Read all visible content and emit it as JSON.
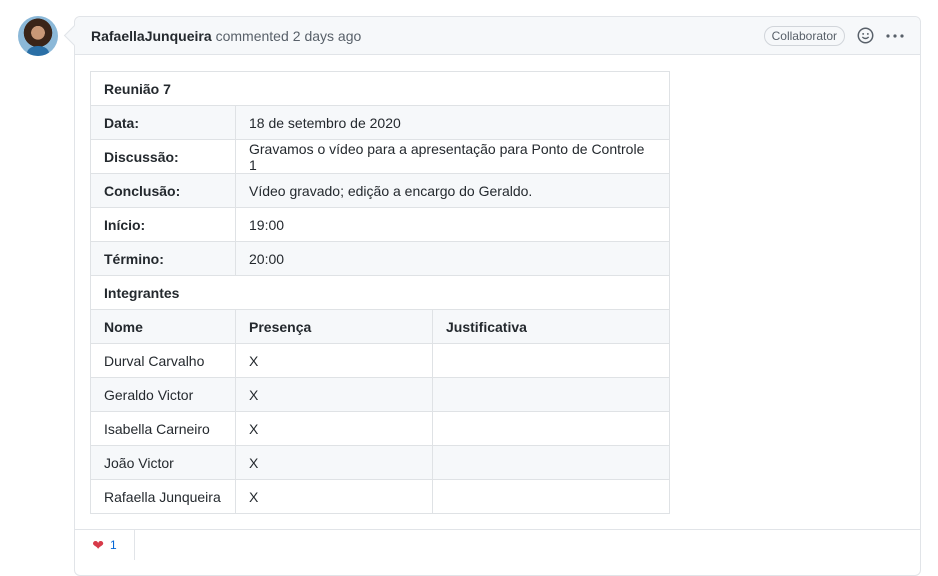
{
  "comment": {
    "author": "RafaellaJunqueira",
    "action": "commented",
    "time": "2 days ago",
    "badge": "Collaborator",
    "icons": {
      "reaction": "smiley-icon",
      "more": "kebab-horizontal-icon"
    }
  },
  "table": {
    "title": "Reunião 7",
    "rows": [
      {
        "label": "Data:",
        "value": "18 de setembro de 2020"
      },
      {
        "label": "Discussão:",
        "value": "Gravamos o vídeo para a apresentação para Ponto de Controle 1"
      },
      {
        "label": "Conclusão:",
        "value": "Vídeo gravado; edição a encargo do Geraldo."
      },
      {
        "label": "Início:",
        "value": "19:00"
      },
      {
        "label": "Término:",
        "value": "20:00"
      }
    ],
    "section": "Integrantes",
    "headers": [
      "Nome",
      "Presença",
      "Justificativa"
    ],
    "members": [
      {
        "name": "Durval Carvalho",
        "presence": "X",
        "justification": ""
      },
      {
        "name": "Geraldo Victor",
        "presence": "X",
        "justification": ""
      },
      {
        "name": "Isabella Carneiro",
        "presence": "X",
        "justification": ""
      },
      {
        "name": "João Victor",
        "presence": "X",
        "justification": ""
      },
      {
        "name": "Rafaella Junqueira",
        "presence": "X",
        "justification": ""
      }
    ]
  },
  "reactions": [
    {
      "icon": "heart-icon",
      "count": "1",
      "color": "#d73a49"
    }
  ]
}
